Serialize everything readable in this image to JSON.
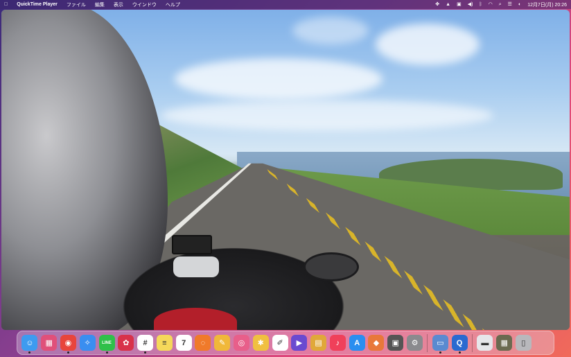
{
  "menubar": {
    "apple": "",
    "app_name": "QuickTime Player",
    "menus": [
      "ファイル",
      "編集",
      "表示",
      "ウインドウ",
      "ヘルプ"
    ],
    "status_icons": [
      "control-center-icon",
      "vpn-icon",
      "screen-icon",
      "volume-icon",
      "bluetooth-icon",
      "wifi-icon",
      "search-icon",
      "control-strip-icon",
      "siri-icon"
    ],
    "clock": "12月7日(月)  20:26"
  },
  "video": {
    "scene": "motorcycle-road-view"
  },
  "dock": {
    "items": [
      {
        "name": "finder",
        "glyph": "☺",
        "color": "#3d9bf0",
        "running": true
      },
      {
        "name": "launchpad",
        "glyph": "▦",
        "color": "#e0507a",
        "running": false
      },
      {
        "name": "chrome",
        "glyph": "◉",
        "color": "#e8453c",
        "running": true
      },
      {
        "name": "safari",
        "glyph": "✧",
        "color": "#3a8ef0",
        "running": false
      },
      {
        "name": "line",
        "glyph": "LINE",
        "color": "#2fc04a",
        "running": true
      },
      {
        "name": "scrobbles",
        "glyph": "✿",
        "color": "#d8324a",
        "running": false
      },
      {
        "name": "slack",
        "glyph": "#",
        "color": "#ffffff",
        "running": true
      },
      {
        "name": "notes",
        "glyph": "≡",
        "color": "#f5d85a",
        "running": false
      },
      {
        "name": "calendar",
        "glyph": "7",
        "color": "#ffffff",
        "running": false
      },
      {
        "name": "activity",
        "glyph": "◌",
        "color": "#f07a2a",
        "running": false
      },
      {
        "name": "pencil-app",
        "glyph": "✎",
        "color": "#f0b83a",
        "running": false
      },
      {
        "name": "screenshot",
        "glyph": "◎",
        "color": "#e85f8a",
        "running": false
      },
      {
        "name": "photos",
        "glyph": "✱",
        "color": "#f0c040",
        "running": false
      },
      {
        "name": "textedit",
        "glyph": "✐",
        "color": "#ffffff",
        "running": false
      },
      {
        "name": "imovie",
        "glyph": "▶",
        "color": "#6a4ad0",
        "running": false
      },
      {
        "name": "folder-app",
        "glyph": "▤",
        "color": "#e0a83a",
        "running": false
      },
      {
        "name": "music",
        "glyph": "♪",
        "color": "#f0405a",
        "running": false
      },
      {
        "name": "app-store",
        "glyph": "A",
        "color": "#2a8ef0",
        "running": false
      },
      {
        "name": "package",
        "glyph": "◆",
        "color": "#e8783a",
        "running": false
      },
      {
        "name": "calculator",
        "glyph": "▣",
        "color": "#555555",
        "running": false
      },
      {
        "name": "system-preferences",
        "glyph": "⚙",
        "color": "#8a8a8e",
        "running": false
      },
      {
        "name": "preview",
        "glyph": "▭",
        "color": "#5a8ad0",
        "running": true
      },
      {
        "name": "quicktime",
        "glyph": "Q",
        "color": "#2a6ad0",
        "running": true
      },
      {
        "name": "downloads-stack",
        "glyph": "▬",
        "color": "#e6e6ea",
        "running": false
      },
      {
        "name": "documents-stack",
        "glyph": "▦",
        "color": "#6a6a50",
        "running": false
      },
      {
        "name": "trash",
        "glyph": "▯",
        "color": "#b8b8bc",
        "running": false
      }
    ]
  }
}
